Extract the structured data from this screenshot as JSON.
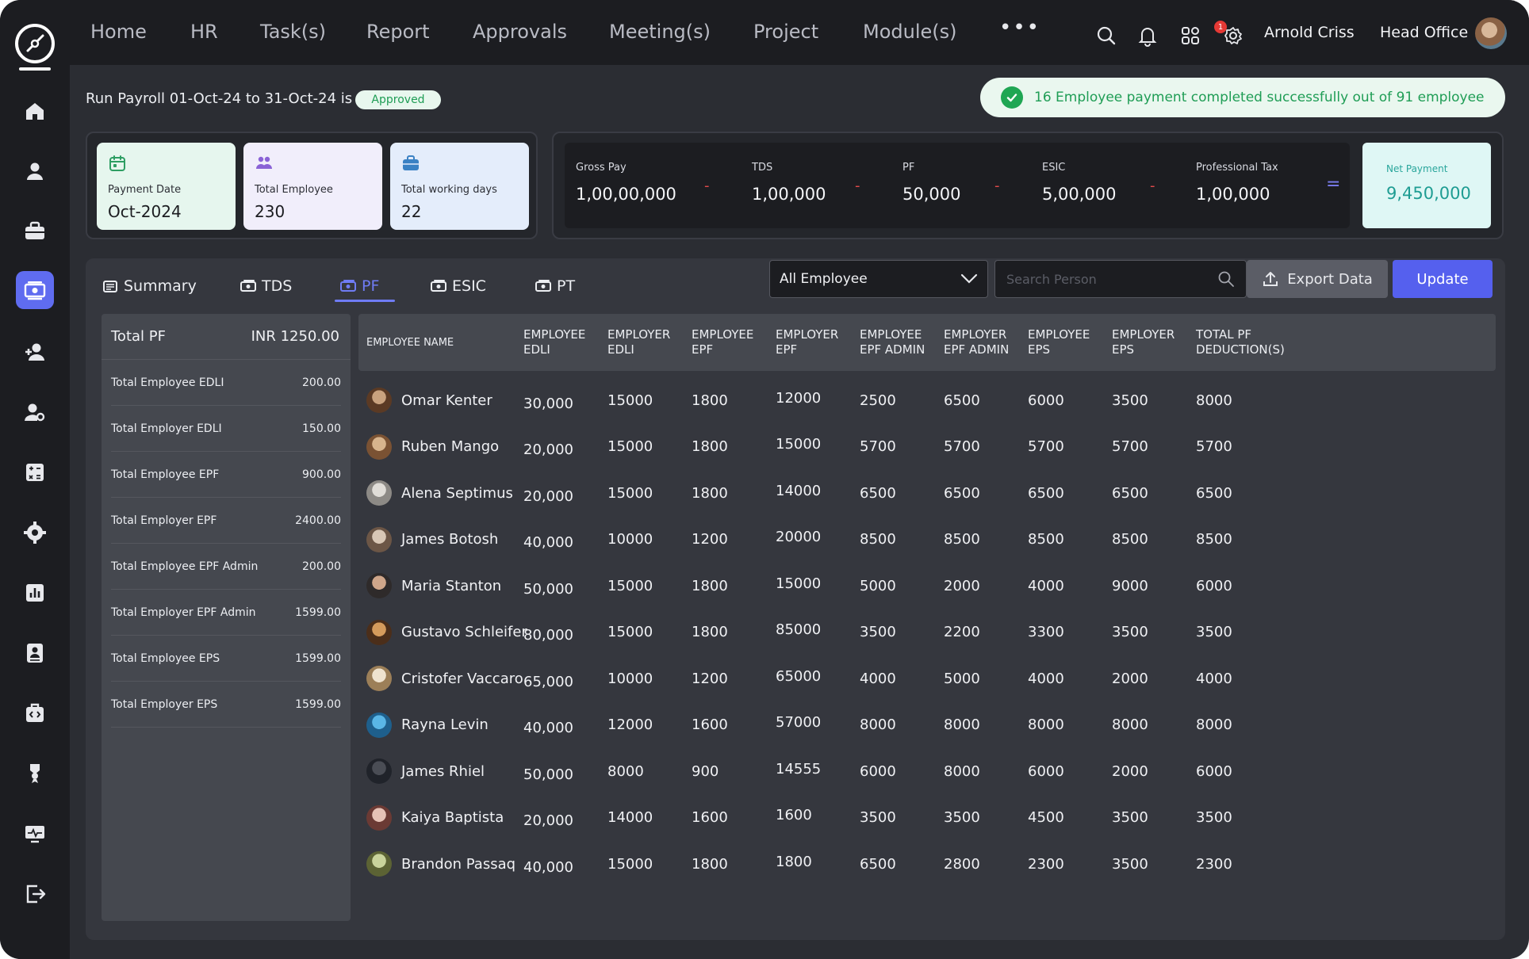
{
  "nav": {
    "items": [
      "Home",
      "HR",
      "Task(s)",
      "Report",
      "Approvals",
      "Meeting(s)",
      "Project",
      "Module(s)"
    ],
    "more": "•••",
    "notification_count": "1",
    "user_name": "Arnold Criss",
    "office": "Head Office"
  },
  "sidebar": {
    "icons": [
      "home-icon",
      "user-icon",
      "briefcase-icon",
      "payroll-icon",
      "add-user-icon",
      "user-settings-icon",
      "calculator-icon",
      "gear-icon",
      "chart-icon",
      "id-card-icon",
      "medical-kit-icon",
      "award-icon",
      "monitor-icon",
      "logout-icon"
    ],
    "active_index": 3
  },
  "header": {
    "title": "Run Payroll 01-Oct-24 to 31-Oct-24 is",
    "status": "Approved",
    "toast": "16 Employee payment completed successfully out of 91 employee"
  },
  "stats": [
    {
      "label": "Payment Date",
      "value": "Oct-2024",
      "icon": "calendar-icon",
      "bg": "#e6f6ee",
      "iconColor": "#2e9e63"
    },
    {
      "label": "Total Employee",
      "value": "230",
      "icon": "people-icon",
      "bg": "#f1eefb",
      "iconColor": "#8a62d6"
    },
    {
      "label": "Total working days",
      "value": "22",
      "icon": "briefcase-icon",
      "bg": "#e4edfb",
      "iconColor": "#3b82c4"
    }
  ],
  "payment": {
    "items": [
      {
        "label": "Gross Pay",
        "value": "1,00,00,000"
      },
      {
        "label": "TDS",
        "value": "1,00,000"
      },
      {
        "label": "PF",
        "value": "50,000"
      },
      {
        "label": "ESIC",
        "value": "5,00,000"
      },
      {
        "label": "Professional Tax",
        "value": "1,00,000"
      }
    ],
    "minus": "-",
    "equals": "=",
    "net_label": "Net Payment",
    "net_value": "9,450,000"
  },
  "tabs": [
    {
      "label": "Summary",
      "active": false
    },
    {
      "label": "TDS",
      "active": false
    },
    {
      "label": "PF",
      "active": true
    },
    {
      "label": "ESIC",
      "active": false
    },
    {
      "label": "PT",
      "active": false
    }
  ],
  "toolbar": {
    "filter_value": "All Employee",
    "search_placeholder": "Search Person",
    "export_label": "Export Data",
    "update_label": "Update"
  },
  "summary": {
    "title": "Total PF",
    "total": "INR 1250.00",
    "rows": [
      {
        "label": "Total Employee EDLI",
        "value": "200.00"
      },
      {
        "label": "Total Employer EDLI",
        "value": "150.00"
      },
      {
        "label": "Total Employee EPF",
        "value": "900.00"
      },
      {
        "label": "Total Employer EPF",
        "value": "2400.00"
      },
      {
        "label": "Total Employee EPF Admin",
        "value": "200.00"
      },
      {
        "label": "Total Employer EPF Admin",
        "value": "1599.00"
      },
      {
        "label": "Total Employee EPS",
        "value": "1599.00"
      },
      {
        "label": "Total Employer EPS",
        "value": "1599.00"
      }
    ]
  },
  "table": {
    "columns": [
      [
        "Employee Name"
      ],
      [
        "Employee",
        "EDLI"
      ],
      [
        "Employer",
        "EDLI"
      ],
      [
        "Employee",
        "EPF"
      ],
      [
        "Employer",
        "EPF"
      ],
      [
        "Employee",
        "EPF Admin"
      ],
      [
        "Employer",
        "EPF Admin"
      ],
      [
        "Employee",
        "EPS"
      ],
      [
        "Employer",
        "EPS"
      ],
      [
        "Total PF",
        "Deduction(s)"
      ]
    ],
    "rows": [
      {
        "name": "Omar Kenter",
        "cells": [
          "30,000",
          "15000",
          "1800",
          "12000",
          "2500",
          "6500",
          "6000",
          "3500",
          "8000"
        ],
        "avatar": [
          "#c9a27e",
          "#5b3a24"
        ]
      },
      {
        "name": "Ruben Mango",
        "cells": [
          "20,000",
          "15000",
          "1800",
          "15000",
          "5700",
          "5700",
          "5700",
          "5700",
          "5700"
        ],
        "avatar": [
          "#d7b48d",
          "#7a5233"
        ]
      },
      {
        "name": "Alena Septimus",
        "cells": [
          "20,000",
          "15000",
          "1800",
          "14000",
          "6500",
          "6500",
          "6500",
          "6500",
          "6500"
        ],
        "avatar": [
          "#e0ddd8",
          "#8d8a86"
        ]
      },
      {
        "name": "James Botosh",
        "cells": [
          "40,000",
          "10000",
          "1200",
          "20000",
          "8500",
          "8500",
          "8500",
          "8500",
          "8500"
        ],
        "avatar": [
          "#d9c7b5",
          "#6c5646"
        ]
      },
      {
        "name": "Maria Stanton",
        "cells": [
          "50,000",
          "15000",
          "1800",
          "15000",
          "5000",
          "2000",
          "4000",
          "9000",
          "6000"
        ],
        "avatar": [
          "#cfa68a",
          "#2e2a2a"
        ]
      },
      {
        "name": "Gustavo Schleifer",
        "cells": [
          "80,000",
          "15000",
          "1800",
          "85000",
          "3500",
          "2200",
          "3300",
          "3500",
          "3500"
        ],
        "avatar": [
          "#d59b5c",
          "#4b2e1a"
        ]
      },
      {
        "name": "Cristofer Vaccaro",
        "cells": [
          "65,000",
          "10000",
          "1200",
          "65000",
          "4000",
          "5000",
          "4000",
          "2000",
          "4000"
        ],
        "avatar": [
          "#efe3cf",
          "#9c7f58"
        ]
      },
      {
        "name": "Rayna Levin",
        "cells": [
          "40,000",
          "12000",
          "1600",
          "57000",
          "8000",
          "8000",
          "8000",
          "8000",
          "8000"
        ],
        "avatar": [
          "#5ab6e6",
          "#1e5f8c"
        ]
      },
      {
        "name": "James Rhiel",
        "cells": [
          "50,000",
          "8000",
          "900",
          "14555",
          "6000",
          "8000",
          "6000",
          "2000",
          "6000"
        ],
        "avatar": [
          "#4a4d55",
          "#20232a"
        ]
      },
      {
        "name": "Kaiya Baptista",
        "cells": [
          "20,000",
          "14000",
          "1600",
          "1600",
          "3500",
          "3500",
          "4500",
          "3500",
          "3500"
        ],
        "avatar": [
          "#e6c2b6",
          "#6b3a34"
        ]
      },
      {
        "name": "Brandon Passaq",
        "cells": [
          "40,000",
          "15000",
          "1800",
          "1800",
          "6500",
          "2800",
          "2300",
          "3500",
          "2300"
        ],
        "avatar": [
          "#c9d39b",
          "#5c6334"
        ]
      }
    ]
  }
}
